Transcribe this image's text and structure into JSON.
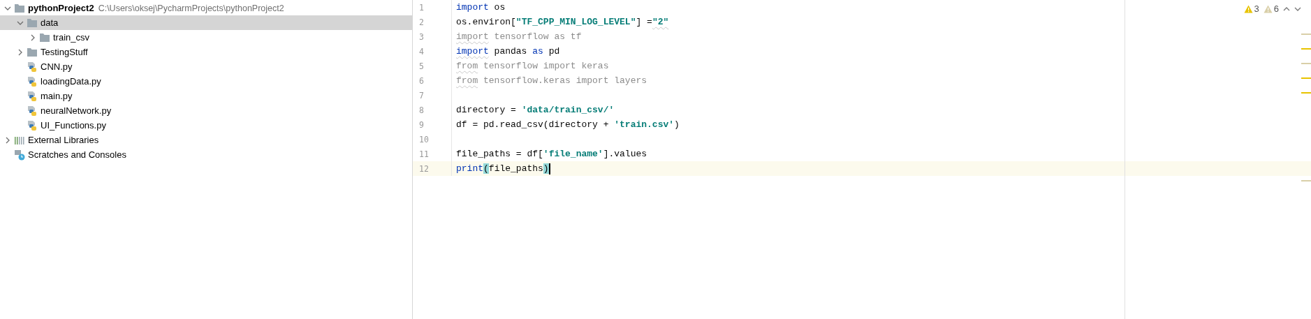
{
  "project_tree": {
    "items": [
      {
        "kind": "project",
        "label": "pythonProject2",
        "path": "C:\\Users\\oksej\\PycharmProjects\\pythonProject2",
        "expanded": true,
        "selected": false,
        "children": [
          {
            "kind": "folder",
            "label": "data",
            "expanded": true,
            "selected": true,
            "children": [
              {
                "kind": "folder",
                "label": "train_csv",
                "expanded": false,
                "selected": false
              }
            ]
          },
          {
            "kind": "folder",
            "label": "TestingStuff",
            "expanded": false,
            "selected": false
          },
          {
            "kind": "python_file",
            "label": "CNN.py",
            "selected": false
          },
          {
            "kind": "python_file",
            "label": "loadingData.py",
            "selected": false
          },
          {
            "kind": "python_file",
            "label": "main.py",
            "selected": false
          },
          {
            "kind": "python_file",
            "label": "neuralNetwork.py",
            "selected": false
          },
          {
            "kind": "python_file",
            "label": "UI_Functions.py",
            "selected": false
          }
        ]
      },
      {
        "kind": "libraries",
        "label": "External Libraries",
        "expanded": false,
        "selected": false
      },
      {
        "kind": "scratches",
        "label": "Scratches and Consoles",
        "selected": false
      }
    ]
  },
  "editor": {
    "inspections": [
      {
        "kind": "warning",
        "count": "3"
      },
      {
        "kind": "weak_warning",
        "count": "6"
      }
    ],
    "lines": [
      {
        "number": "1",
        "current": false,
        "tokens": [
          {
            "text": "import",
            "kind": "keyword"
          },
          {
            "text": " os",
            "kind": "plain"
          }
        ]
      },
      {
        "number": "2",
        "current": false,
        "tokens": [
          {
            "text": "os.environ[",
            "kind": "plain"
          },
          {
            "text": "\"TF_CPP_MIN_LOG_LEVEL\"",
            "kind": "string"
          },
          {
            "text": "] =",
            "kind": "plain"
          },
          {
            "text": "\"2\"",
            "kind": "string",
            "warn": true
          }
        ]
      },
      {
        "number": "3",
        "current": false,
        "tokens": [
          {
            "text": "import",
            "kind": "unused",
            "warn": true
          },
          {
            "text": " tensorflow as tf",
            "kind": "unused"
          }
        ]
      },
      {
        "number": "4",
        "current": false,
        "tokens": [
          {
            "text": "import",
            "kind": "keyword",
            "warn": true
          },
          {
            "text": " pandas ",
            "kind": "plain"
          },
          {
            "text": "as",
            "kind": "keyword"
          },
          {
            "text": " pd",
            "kind": "plain"
          }
        ]
      },
      {
        "number": "5",
        "current": false,
        "tokens": [
          {
            "text": "from",
            "kind": "unused",
            "warn": true
          },
          {
            "text": " tensorflow import keras",
            "kind": "unused"
          }
        ]
      },
      {
        "number": "6",
        "current": false,
        "tokens": [
          {
            "text": "from",
            "kind": "unused",
            "warn": true
          },
          {
            "text": " tensorflow.keras import layers",
            "kind": "unused"
          }
        ]
      },
      {
        "number": "7",
        "current": false
      },
      {
        "number": "8",
        "current": false,
        "tokens": [
          {
            "text": "directory = ",
            "kind": "plain"
          },
          {
            "text": "'data/train_csv/'",
            "kind": "string"
          }
        ]
      },
      {
        "number": "9",
        "current": false,
        "tokens": [
          {
            "text": "df = pd.read_csv(directory + ",
            "kind": "plain"
          },
          {
            "text": "'train.csv'",
            "kind": "string"
          },
          {
            "text": ")",
            "kind": "plain"
          }
        ]
      },
      {
        "number": "10",
        "current": false
      },
      {
        "number": "11",
        "current": false,
        "tokens": [
          {
            "text": "file_paths = df[",
            "kind": "plain"
          },
          {
            "text": "'file_name'",
            "kind": "string"
          },
          {
            "text": "].values",
            "kind": "plain"
          }
        ]
      },
      {
        "number": "12",
        "current": true,
        "tokens": [
          {
            "text": "print",
            "kind": "keyword"
          },
          {
            "text": "(",
            "kind": "brace_match"
          },
          {
            "text": "file_paths",
            "kind": "plain"
          },
          {
            "text": ")",
            "kind": "brace_match"
          }
        ]
      }
    ]
  }
}
